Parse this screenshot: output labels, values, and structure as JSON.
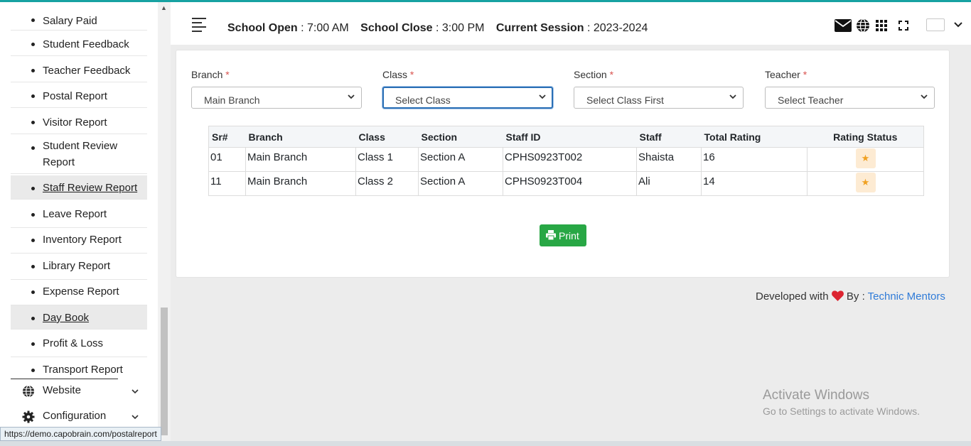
{
  "sidebar": {
    "items": [
      {
        "label": "Salary Paid"
      },
      {
        "label": "Student Feedback"
      },
      {
        "label": "Teacher Feedback"
      },
      {
        "label": "Postal Report"
      },
      {
        "label": "Visitor Report"
      },
      {
        "label": "Student Review Report"
      },
      {
        "label": "Staff Review Report"
      },
      {
        "label": "Leave Report"
      },
      {
        "label": "Inventory Report"
      },
      {
        "label": "Library Report"
      },
      {
        "label": "Expense Report"
      },
      {
        "label": "Day Book"
      },
      {
        "label": "Profit & Loss"
      },
      {
        "label": "Transport Report"
      }
    ],
    "groups": [
      {
        "label": "Website",
        "icon": "globe-icon"
      },
      {
        "label": "Configuration",
        "icon": "gear-icon"
      }
    ]
  },
  "header": {
    "school_open_label": "School Open",
    "school_open_value": ": 7:00 AM",
    "school_close_label": "School Close",
    "school_close_value": ": 3:00 PM",
    "session_label": "Current Session",
    "session_value": ": 2023-2024",
    "icons": [
      "envelope-icon",
      "globe-icon",
      "grid-icon",
      "fullscreen-icon",
      "avatar",
      "chevron-down-icon"
    ]
  },
  "filters": {
    "branch": {
      "label": "Branch",
      "required": "*",
      "value": "Main Branch"
    },
    "class": {
      "label": "Class",
      "required": "*",
      "value": "Select Class"
    },
    "section": {
      "label": "Section",
      "required": "*",
      "value": "Select Class First"
    },
    "teacher": {
      "label": "Teacher",
      "required": "*",
      "value": "Select Teacher"
    }
  },
  "table": {
    "headers": [
      "Sr#",
      "Branch",
      "Class",
      "Section",
      "Staff ID",
      "Staff",
      "Total Rating",
      "Rating Status"
    ],
    "rows": [
      {
        "sr": "01",
        "branch": "Main Branch",
        "class": "Class 1",
        "section": "Section A",
        "staff_id": "CPHS0923T002",
        "staff": "Shaista",
        "rating": "16",
        "status_icon": "star-icon"
      },
      {
        "sr": "11",
        "branch": "Main Branch",
        "class": "Class 2",
        "section": "Section A",
        "staff_id": "CPHS0923T004",
        "staff": "Ali",
        "rating": "14",
        "status_icon": "star-icon"
      }
    ]
  },
  "print_button": {
    "label": "Print"
  },
  "footer": {
    "prefix": "Developed with",
    "by": "By :",
    "link": "Technic Mentors"
  },
  "watermark": {
    "line1": "Activate Windows",
    "line2": "Go to Settings to activate Windows."
  },
  "status_url": "https://demo.capobrain.com/postalreport",
  "colors": {
    "accent": "#17a2a2",
    "print": "#28a745",
    "link": "#2f7bd8",
    "required": "#d9534f",
    "star": "#f0a020"
  }
}
